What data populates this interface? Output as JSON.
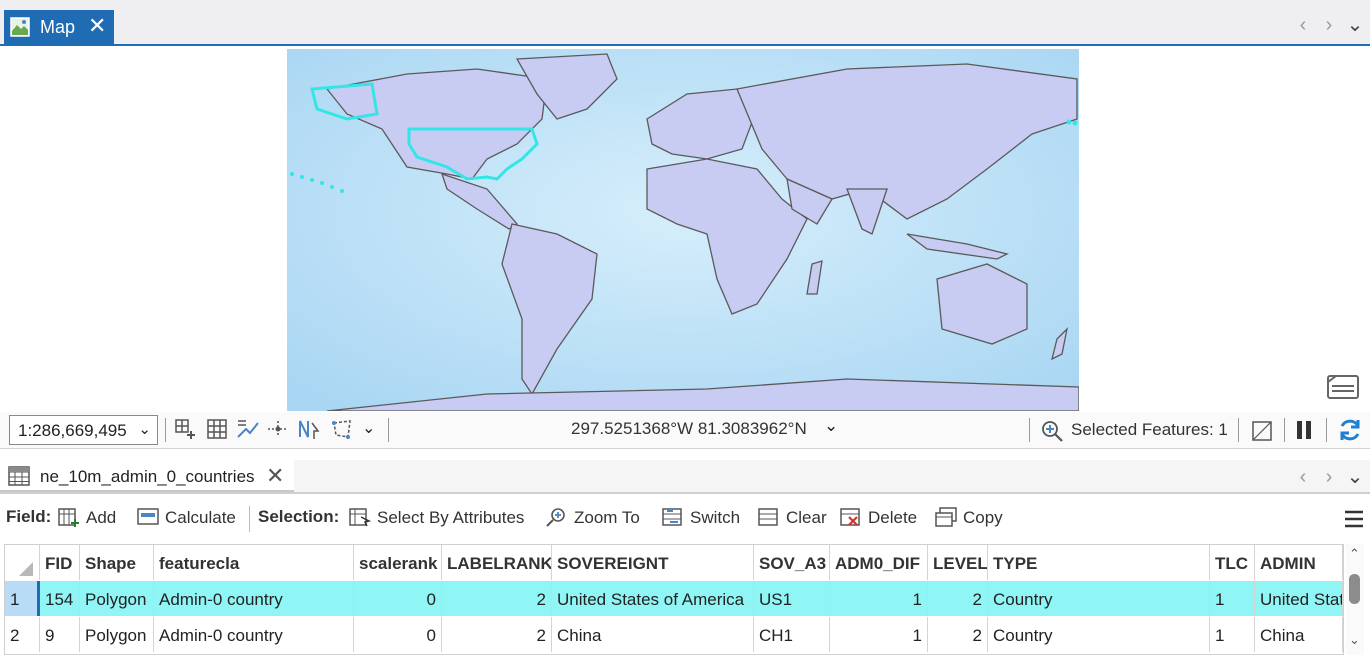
{
  "map_tab": {
    "label": "Map",
    "close": "✕"
  },
  "nav": {
    "prev": "‹",
    "next": "›",
    "menu": "⌄"
  },
  "statusbar": {
    "scale": "1:286,669,495",
    "coordinates": "297.5251368°W 81.3083962°N",
    "selected_features": "Selected Features: 1"
  },
  "table_tab": {
    "label": "ne_10m_admin_0_countries",
    "close": "✕"
  },
  "toolbar": {
    "field_label": "Field:",
    "add": "Add",
    "calculate": "Calculate",
    "selection_label": "Selection:",
    "select_by_attributes": "Select By Attributes",
    "zoom_to": "Zoom To",
    "switch": "Switch",
    "clear": "Clear",
    "delete": "Delete",
    "copy": "Copy"
  },
  "table": {
    "columns": [
      "FID",
      "Shape",
      "featurecla",
      "scalerank",
      "LABELRANK",
      "SOVEREIGNT",
      "SOV_A3",
      "ADM0_DIF",
      "LEVEL",
      "TYPE",
      "TLC",
      "ADMIN"
    ],
    "rows": [
      {
        "num": "1",
        "FID": "154",
        "Shape": "Polygon",
        "featurecla": "Admin-0 country",
        "scalerank": "0",
        "LABELRANK": "2",
        "SOVEREIGNT": "United States of America",
        "SOV_A3": "US1",
        "ADM0_DIF": "1",
        "LEVEL": "2",
        "TYPE": "Country",
        "TLC": "1",
        "ADMIN": "United States of America"
      },
      {
        "num": "2",
        "FID": "9",
        "Shape": "Polygon",
        "featurecla": "Admin-0 country",
        "scalerank": "0",
        "LABELRANK": "2",
        "SOVEREIGNT": "China",
        "SOV_A3": "CH1",
        "ADM0_DIF": "1",
        "LEVEL": "2",
        "TYPE": "Country",
        "TLC": "1",
        "ADMIN": "China"
      }
    ]
  },
  "colors": {
    "accent": "#1f6cb5",
    "selection": "#8ff5f5",
    "ocean": "#bfe3f7",
    "land": "#c8cbf2",
    "highlight": "#33e6e6"
  }
}
